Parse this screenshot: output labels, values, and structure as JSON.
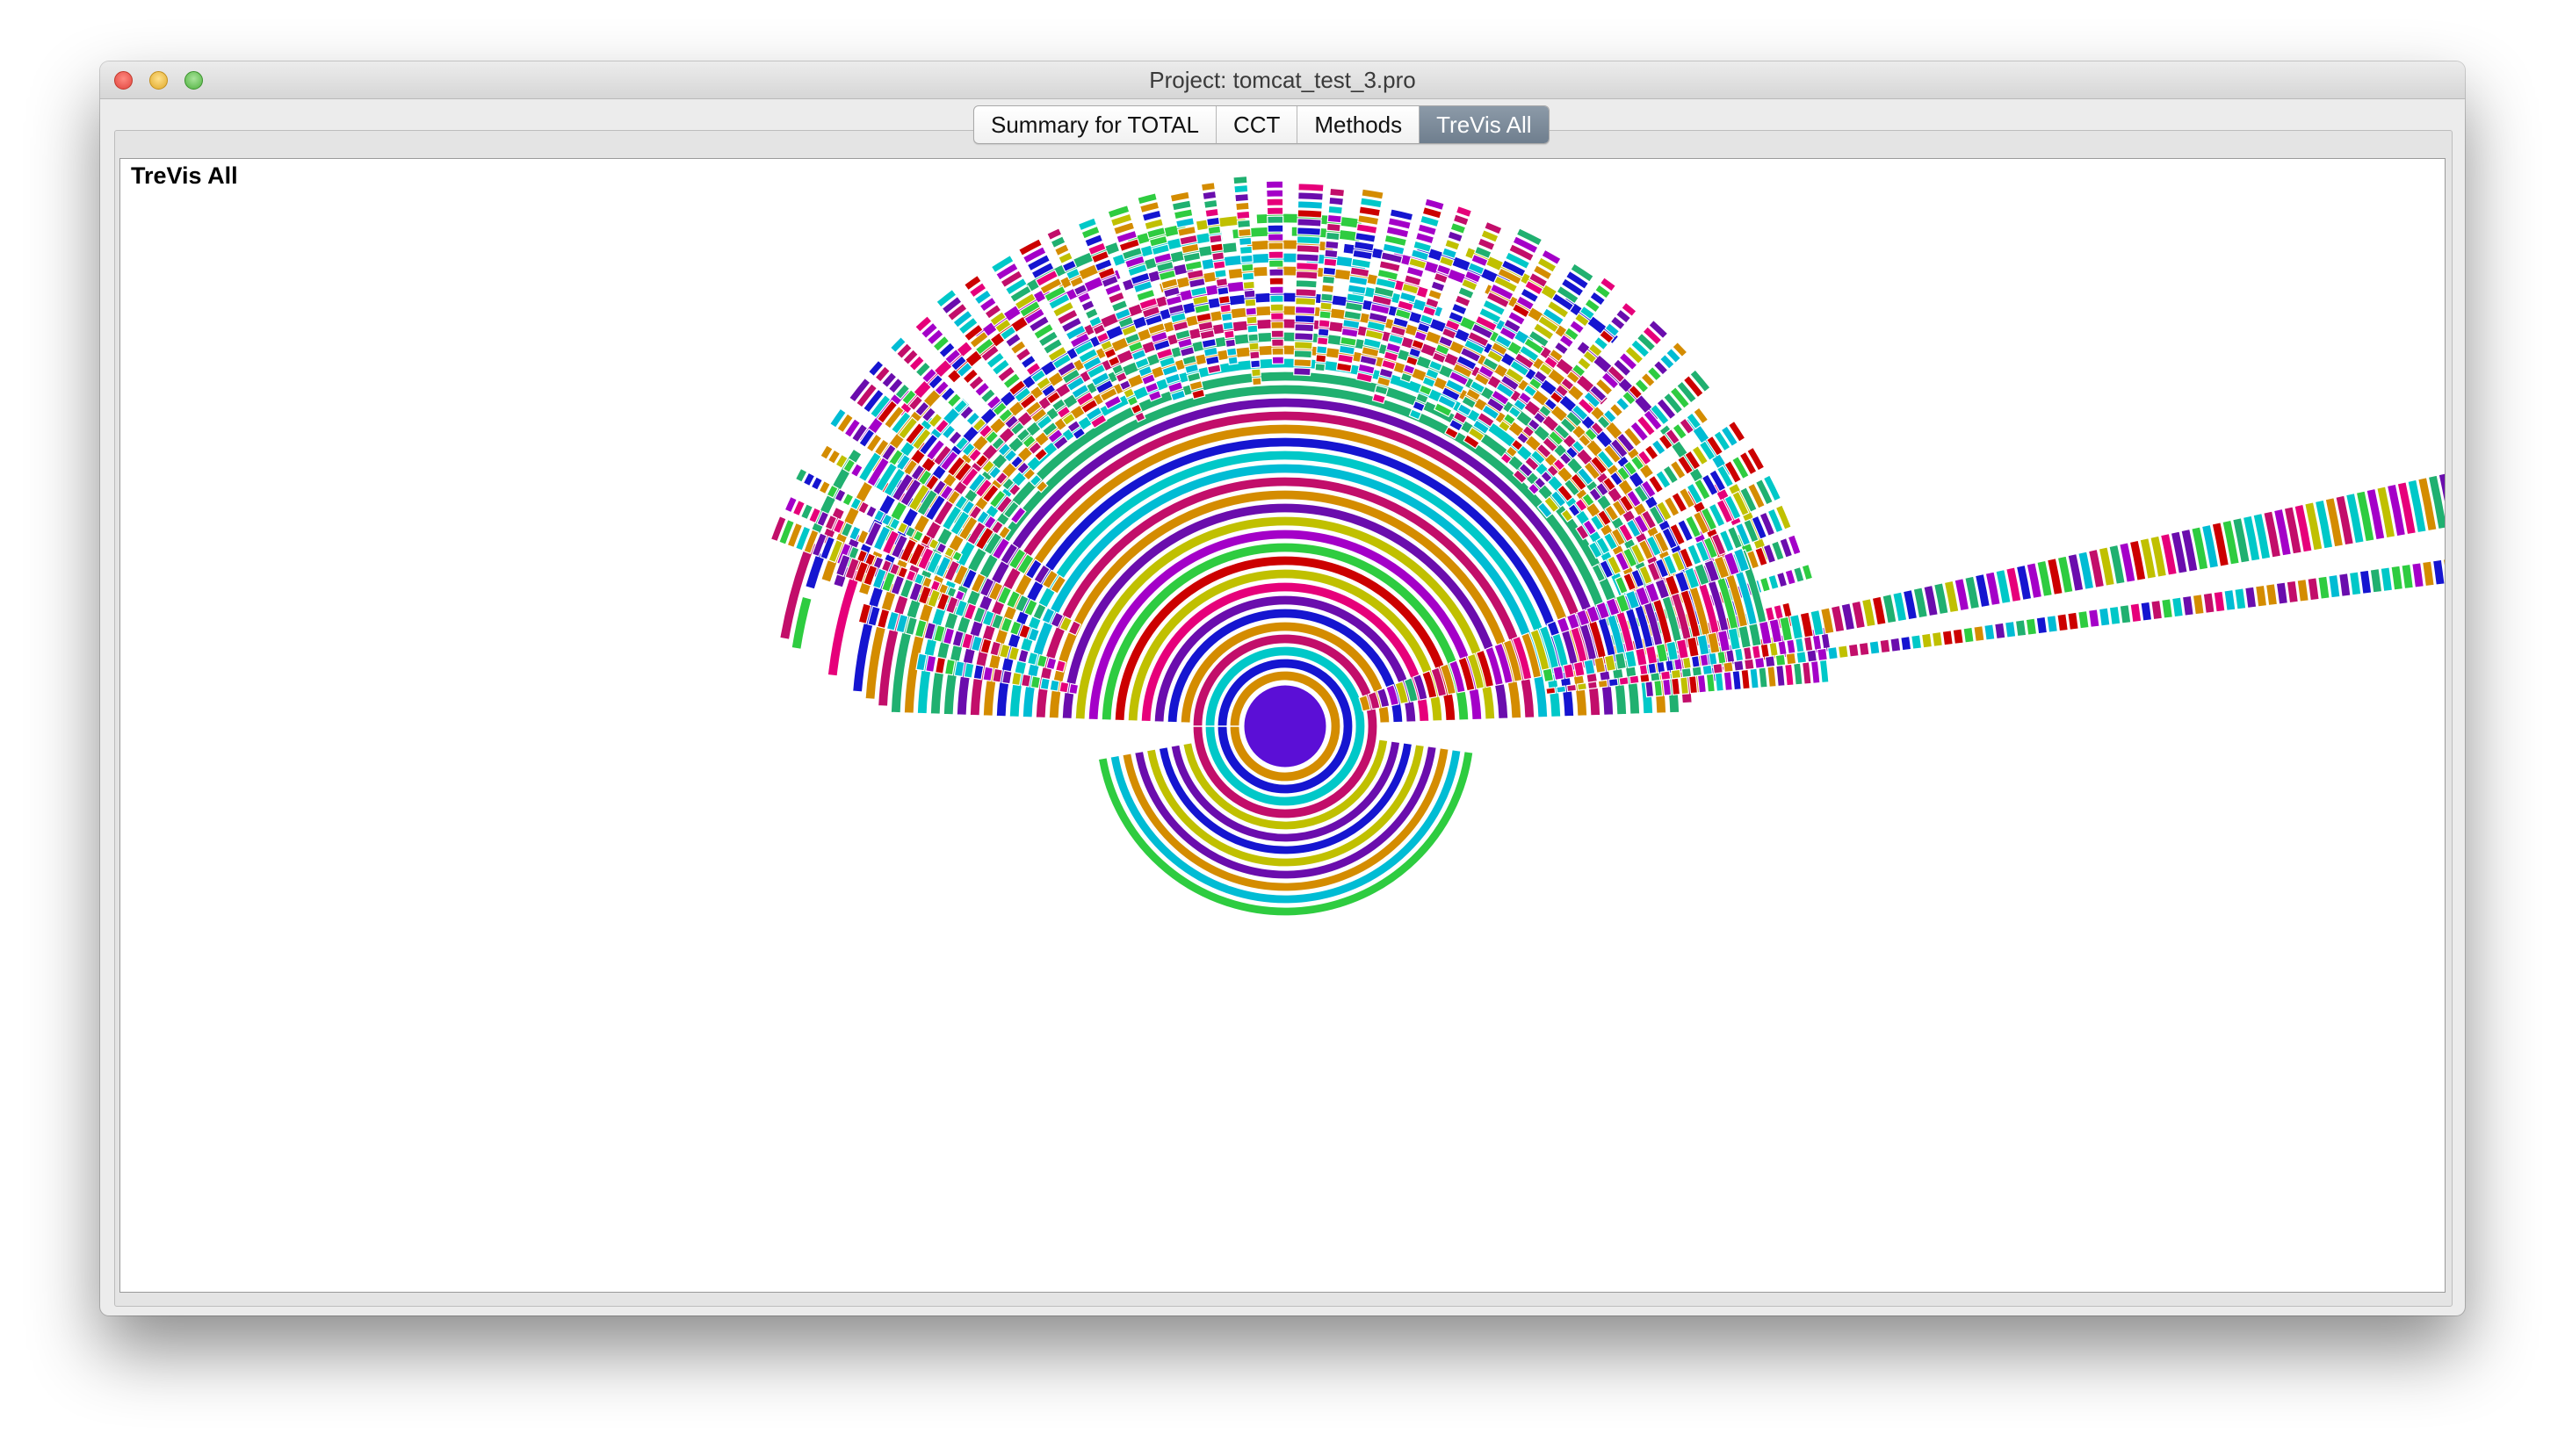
{
  "window": {
    "title": "Project: tomcat_test_3.pro",
    "controls": [
      "close",
      "minimize",
      "zoom"
    ]
  },
  "tabs": [
    {
      "label": "Summary for TOTAL",
      "active": false
    },
    {
      "label": "CCT",
      "active": false
    },
    {
      "label": "Methods",
      "active": false
    },
    {
      "label": "TreVis All",
      "active": true
    }
  ],
  "panel": {
    "title": "TreVis All"
  },
  "visualization": {
    "type": "sunburst",
    "root_color": "#5b0fd6",
    "palette": [
      "#6a0dad",
      "#ffffff",
      "#00c8c8",
      "#c20e6a",
      "#2ecc40",
      "#cc0000",
      "#d48c00",
      "#1515d0",
      "#c0c000",
      "#00bcd4",
      "#a400c8",
      "#e6007a",
      "#20b070"
    ]
  }
}
